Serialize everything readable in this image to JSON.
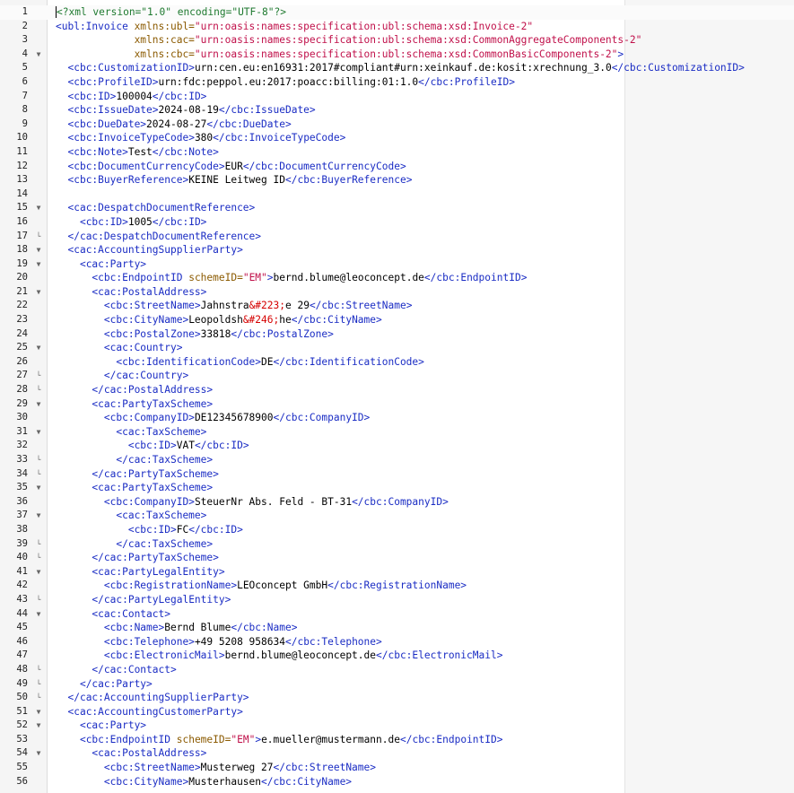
{
  "editor": {
    "lines": [
      {
        "n": "1",
        "fold": "",
        "segments": [
          {
            "t": "<?xml version=\"1.0\" encoding=\"UTF-8\"?>",
            "c": "pi"
          }
        ]
      },
      {
        "n": "2",
        "fold": "",
        "segments": [
          {
            "t": "<ubl:Invoice ",
            "c": "tag"
          },
          {
            "t": "xmlns:ubl=",
            "c": "attr"
          },
          {
            "t": "\"urn:oasis:names:specification:ubl:schema:xsd:Invoice-2\"",
            "c": "str"
          }
        ]
      },
      {
        "n": "3",
        "fold": "",
        "segments": [
          {
            "t": "             ",
            "c": "txt"
          },
          {
            "t": "xmlns:cac=",
            "c": "attr"
          },
          {
            "t": "\"urn:oasis:names:specification:ubl:schema:xsd:CommonAggregateComponents-2\"",
            "c": "str"
          }
        ]
      },
      {
        "n": "4",
        "fold": "▼",
        "segments": [
          {
            "t": "             ",
            "c": "txt"
          },
          {
            "t": "xmlns:cbc=",
            "c": "attr"
          },
          {
            "t": "\"urn:oasis:names:specification:ubl:schema:xsd:CommonBasicComponents-2\"",
            "c": "str"
          },
          {
            "t": ">",
            "c": "tag"
          }
        ]
      },
      {
        "n": "5",
        "fold": "",
        "segments": [
          {
            "t": "  ",
            "c": "txt"
          },
          {
            "t": "<cbc:CustomizationID>",
            "c": "tag"
          },
          {
            "t": "urn:cen.eu:en16931:2017#compliant#urn:xeinkauf.de:kosit:xrechnung_3.0",
            "c": "txt"
          },
          {
            "t": "</cbc:CustomizationID>",
            "c": "tag"
          }
        ]
      },
      {
        "n": "6",
        "fold": "",
        "segments": [
          {
            "t": "  ",
            "c": "txt"
          },
          {
            "t": "<cbc:ProfileID>",
            "c": "tag"
          },
          {
            "t": "urn:fdc:peppol.eu:2017:poacc:billing:01:1.0",
            "c": "txt"
          },
          {
            "t": "</cbc:ProfileID>",
            "c": "tag"
          }
        ]
      },
      {
        "n": "7",
        "fold": "",
        "segments": [
          {
            "t": "  ",
            "c": "txt"
          },
          {
            "t": "<cbc:ID>",
            "c": "tag"
          },
          {
            "t": "100004",
            "c": "txt"
          },
          {
            "t": "</cbc:ID>",
            "c": "tag"
          }
        ]
      },
      {
        "n": "8",
        "fold": "",
        "segments": [
          {
            "t": "  ",
            "c": "txt"
          },
          {
            "t": "<cbc:IssueDate>",
            "c": "tag"
          },
          {
            "t": "2024-08-19",
            "c": "txt"
          },
          {
            "t": "</cbc:IssueDate>",
            "c": "tag"
          }
        ]
      },
      {
        "n": "9",
        "fold": "",
        "segments": [
          {
            "t": "  ",
            "c": "txt"
          },
          {
            "t": "<cbc:DueDate>",
            "c": "tag"
          },
          {
            "t": "2024-08-27",
            "c": "txt"
          },
          {
            "t": "</cbc:DueDate>",
            "c": "tag"
          }
        ]
      },
      {
        "n": "10",
        "fold": "",
        "segments": [
          {
            "t": "  ",
            "c": "txt"
          },
          {
            "t": "<cbc:InvoiceTypeCode>",
            "c": "tag"
          },
          {
            "t": "380",
            "c": "txt"
          },
          {
            "t": "</cbc:InvoiceTypeCode>",
            "c": "tag"
          }
        ]
      },
      {
        "n": "11",
        "fold": "",
        "segments": [
          {
            "t": "  ",
            "c": "txt"
          },
          {
            "t": "<cbc:Note>",
            "c": "tag"
          },
          {
            "t": "Test",
            "c": "txt"
          },
          {
            "t": "</cbc:Note>",
            "c": "tag"
          }
        ]
      },
      {
        "n": "12",
        "fold": "",
        "segments": [
          {
            "t": "  ",
            "c": "txt"
          },
          {
            "t": "<cbc:DocumentCurrencyCode>",
            "c": "tag"
          },
          {
            "t": "EUR",
            "c": "txt"
          },
          {
            "t": "</cbc:DocumentCurrencyCode>",
            "c": "tag"
          }
        ]
      },
      {
        "n": "13",
        "fold": "",
        "segments": [
          {
            "t": "  ",
            "c": "txt"
          },
          {
            "t": "<cbc:BuyerReference>",
            "c": "tag"
          },
          {
            "t": "KEINE Leitweg ID",
            "c": "txt"
          },
          {
            "t": "</cbc:BuyerReference>",
            "c": "tag"
          }
        ]
      },
      {
        "n": "14",
        "fold": "",
        "segments": []
      },
      {
        "n": "15",
        "fold": "▼",
        "segments": [
          {
            "t": "  ",
            "c": "txt"
          },
          {
            "t": "<cac:DespatchDocumentReference>",
            "c": "tag"
          }
        ]
      },
      {
        "n": "16",
        "fold": "",
        "segments": [
          {
            "t": "    ",
            "c": "txt"
          },
          {
            "t": "<cbc:ID>",
            "c": "tag"
          },
          {
            "t": "1005",
            "c": "txt"
          },
          {
            "t": "</cbc:ID>",
            "c": "tag"
          }
        ]
      },
      {
        "n": "17",
        "fold": "└",
        "segments": [
          {
            "t": "  ",
            "c": "txt"
          },
          {
            "t": "</cac:DespatchDocumentReference>",
            "c": "tag"
          }
        ]
      },
      {
        "n": "18",
        "fold": "▼",
        "segments": [
          {
            "t": "  ",
            "c": "txt"
          },
          {
            "t": "<cac:AccountingSupplierParty>",
            "c": "tag"
          }
        ]
      },
      {
        "n": "19",
        "fold": "▼",
        "segments": [
          {
            "t": "    ",
            "c": "txt"
          },
          {
            "t": "<cac:Party>",
            "c": "tag"
          }
        ]
      },
      {
        "n": "20",
        "fold": "",
        "segments": [
          {
            "t": "      ",
            "c": "txt"
          },
          {
            "t": "<cbc:EndpointID ",
            "c": "tag"
          },
          {
            "t": "schemeID=",
            "c": "attr"
          },
          {
            "t": "\"EM\"",
            "c": "str"
          },
          {
            "t": ">",
            "c": "tag"
          },
          {
            "t": "bernd.blume@leoconcept.de",
            "c": "txt"
          },
          {
            "t": "</cbc:EndpointID>",
            "c": "tag"
          }
        ]
      },
      {
        "n": "21",
        "fold": "▼",
        "segments": [
          {
            "t": "      ",
            "c": "txt"
          },
          {
            "t": "<cac:PostalAddress>",
            "c": "tag"
          }
        ]
      },
      {
        "n": "22",
        "fold": "",
        "segments": [
          {
            "t": "        ",
            "c": "txt"
          },
          {
            "t": "<cbc:StreetName>",
            "c": "tag"
          },
          {
            "t": "Jahnstra",
            "c": "txt"
          },
          {
            "t": "&#223;",
            "c": "ent"
          },
          {
            "t": "e 29",
            "c": "txt"
          },
          {
            "t": "</cbc:StreetName>",
            "c": "tag"
          }
        ]
      },
      {
        "n": "23",
        "fold": "",
        "segments": [
          {
            "t": "        ",
            "c": "txt"
          },
          {
            "t": "<cbc:CityName>",
            "c": "tag"
          },
          {
            "t": "Leopoldsh",
            "c": "txt"
          },
          {
            "t": "&#246;",
            "c": "ent"
          },
          {
            "t": "he",
            "c": "txt"
          },
          {
            "t": "</cbc:CityName>",
            "c": "tag"
          }
        ]
      },
      {
        "n": "24",
        "fold": "",
        "segments": [
          {
            "t": "        ",
            "c": "txt"
          },
          {
            "t": "<cbc:PostalZone>",
            "c": "tag"
          },
          {
            "t": "33818",
            "c": "txt"
          },
          {
            "t": "</cbc:PostalZone>",
            "c": "tag"
          }
        ]
      },
      {
        "n": "25",
        "fold": "▼",
        "segments": [
          {
            "t": "        ",
            "c": "txt"
          },
          {
            "t": "<cac:Country>",
            "c": "tag"
          }
        ]
      },
      {
        "n": "26",
        "fold": "",
        "segments": [
          {
            "t": "          ",
            "c": "txt"
          },
          {
            "t": "<cbc:IdentificationCode>",
            "c": "tag"
          },
          {
            "t": "DE",
            "c": "txt"
          },
          {
            "t": "</cbc:IdentificationCode>",
            "c": "tag"
          }
        ]
      },
      {
        "n": "27",
        "fold": "└",
        "segments": [
          {
            "t": "        ",
            "c": "txt"
          },
          {
            "t": "</cac:Country>",
            "c": "tag"
          }
        ]
      },
      {
        "n": "28",
        "fold": "└",
        "segments": [
          {
            "t": "      ",
            "c": "txt"
          },
          {
            "t": "</cac:PostalAddress>",
            "c": "tag"
          }
        ]
      },
      {
        "n": "29",
        "fold": "▼",
        "segments": [
          {
            "t": "      ",
            "c": "txt"
          },
          {
            "t": "<cac:PartyTaxScheme>",
            "c": "tag"
          }
        ]
      },
      {
        "n": "30",
        "fold": "",
        "segments": [
          {
            "t": "        ",
            "c": "txt"
          },
          {
            "t": "<cbc:CompanyID>",
            "c": "tag"
          },
          {
            "t": "DE12345678900",
            "c": "txt"
          },
          {
            "t": "</cbc:CompanyID>",
            "c": "tag"
          }
        ]
      },
      {
        "n": "31",
        "fold": "▼",
        "segments": [
          {
            "t": "          ",
            "c": "txt"
          },
          {
            "t": "<cac:TaxScheme>",
            "c": "tag"
          }
        ]
      },
      {
        "n": "32",
        "fold": "",
        "segments": [
          {
            "t": "            ",
            "c": "txt"
          },
          {
            "t": "<cbc:ID>",
            "c": "tag"
          },
          {
            "t": "VAT",
            "c": "txt"
          },
          {
            "t": "</cbc:ID>",
            "c": "tag"
          }
        ]
      },
      {
        "n": "33",
        "fold": "└",
        "segments": [
          {
            "t": "          ",
            "c": "txt"
          },
          {
            "t": "</cac:TaxScheme>",
            "c": "tag"
          }
        ]
      },
      {
        "n": "34",
        "fold": "└",
        "segments": [
          {
            "t": "      ",
            "c": "txt"
          },
          {
            "t": "</cac:PartyTaxScheme>",
            "c": "tag"
          }
        ]
      },
      {
        "n": "35",
        "fold": "▼",
        "segments": [
          {
            "t": "      ",
            "c": "txt"
          },
          {
            "t": "<cac:PartyTaxScheme>",
            "c": "tag"
          }
        ]
      },
      {
        "n": "36",
        "fold": "",
        "segments": [
          {
            "t": "        ",
            "c": "txt"
          },
          {
            "t": "<cbc:CompanyID>",
            "c": "tag"
          },
          {
            "t": "SteuerNr Abs. Feld - BT-31",
            "c": "txt"
          },
          {
            "t": "</cbc:CompanyID>",
            "c": "tag"
          }
        ]
      },
      {
        "n": "37",
        "fold": "▼",
        "segments": [
          {
            "t": "          ",
            "c": "txt"
          },
          {
            "t": "<cac:TaxScheme>",
            "c": "tag"
          }
        ]
      },
      {
        "n": "38",
        "fold": "",
        "segments": [
          {
            "t": "            ",
            "c": "txt"
          },
          {
            "t": "<cbc:ID>",
            "c": "tag"
          },
          {
            "t": "FC",
            "c": "txt"
          },
          {
            "t": "</cbc:ID>",
            "c": "tag"
          }
        ]
      },
      {
        "n": "39",
        "fold": "└",
        "segments": [
          {
            "t": "          ",
            "c": "txt"
          },
          {
            "t": "</cac:TaxScheme>",
            "c": "tag"
          }
        ]
      },
      {
        "n": "40",
        "fold": "└",
        "segments": [
          {
            "t": "      ",
            "c": "txt"
          },
          {
            "t": "</cac:PartyTaxScheme>",
            "c": "tag"
          }
        ]
      },
      {
        "n": "41",
        "fold": "▼",
        "segments": [
          {
            "t": "      ",
            "c": "txt"
          },
          {
            "t": "<cac:PartyLegalEntity>",
            "c": "tag"
          }
        ]
      },
      {
        "n": "42",
        "fold": "",
        "segments": [
          {
            "t": "        ",
            "c": "txt"
          },
          {
            "t": "<cbc:RegistrationName>",
            "c": "tag"
          },
          {
            "t": "LEOconcept GmbH",
            "c": "txt"
          },
          {
            "t": "</cbc:RegistrationName>",
            "c": "tag"
          }
        ]
      },
      {
        "n": "43",
        "fold": "└",
        "segments": [
          {
            "t": "      ",
            "c": "txt"
          },
          {
            "t": "</cac:PartyLegalEntity>",
            "c": "tag"
          }
        ]
      },
      {
        "n": "44",
        "fold": "▼",
        "segments": [
          {
            "t": "      ",
            "c": "txt"
          },
          {
            "t": "<cac:Contact>",
            "c": "tag"
          }
        ]
      },
      {
        "n": "45",
        "fold": "",
        "segments": [
          {
            "t": "        ",
            "c": "txt"
          },
          {
            "t": "<cbc:Name>",
            "c": "tag"
          },
          {
            "t": "Bernd Blume",
            "c": "txt"
          },
          {
            "t": "</cbc:Name>",
            "c": "tag"
          }
        ]
      },
      {
        "n": "46",
        "fold": "",
        "segments": [
          {
            "t": "        ",
            "c": "txt"
          },
          {
            "t": "<cbc:Telephone>",
            "c": "tag"
          },
          {
            "t": "+49 5208 958634",
            "c": "txt"
          },
          {
            "t": "</cbc:Telephone>",
            "c": "tag"
          }
        ]
      },
      {
        "n": "47",
        "fold": "",
        "segments": [
          {
            "t": "        ",
            "c": "txt"
          },
          {
            "t": "<cbc:ElectronicMail>",
            "c": "tag"
          },
          {
            "t": "bernd.blume@leoconcept.de",
            "c": "txt"
          },
          {
            "t": "</cbc:ElectronicMail>",
            "c": "tag"
          }
        ]
      },
      {
        "n": "48",
        "fold": "└",
        "segments": [
          {
            "t": "      ",
            "c": "txt"
          },
          {
            "t": "</cac:Contact>",
            "c": "tag"
          }
        ]
      },
      {
        "n": "49",
        "fold": "└",
        "segments": [
          {
            "t": "    ",
            "c": "txt"
          },
          {
            "t": "</cac:Party>",
            "c": "tag"
          }
        ]
      },
      {
        "n": "50",
        "fold": "└",
        "segments": [
          {
            "t": "  ",
            "c": "txt"
          },
          {
            "t": "</cac:AccountingSupplierParty>",
            "c": "tag"
          }
        ]
      },
      {
        "n": "51",
        "fold": "▼",
        "segments": [
          {
            "t": "  ",
            "c": "txt"
          },
          {
            "t": "<cac:AccountingCustomerParty>",
            "c": "tag"
          }
        ]
      },
      {
        "n": "52",
        "fold": "▼",
        "segments": [
          {
            "t": "    ",
            "c": "txt"
          },
          {
            "t": "<cac:Party>",
            "c": "tag"
          }
        ]
      },
      {
        "n": "53",
        "fold": "",
        "segments": [
          {
            "t": "    ",
            "c": "txt"
          },
          {
            "t": "<cbc:EndpointID ",
            "c": "tag"
          },
          {
            "t": "schemeID=",
            "c": "attr"
          },
          {
            "t": "\"EM\"",
            "c": "str"
          },
          {
            "t": ">",
            "c": "tag"
          },
          {
            "t": "e.mueller@mustermann.de",
            "c": "txt"
          },
          {
            "t": "</cbc:EndpointID>",
            "c": "tag"
          }
        ]
      },
      {
        "n": "54",
        "fold": "▼",
        "segments": [
          {
            "t": "      ",
            "c": "txt"
          },
          {
            "t": "<cac:PostalAddress>",
            "c": "tag"
          }
        ]
      },
      {
        "n": "55",
        "fold": "",
        "segments": [
          {
            "t": "        ",
            "c": "txt"
          },
          {
            "t": "<cbc:StreetName>",
            "c": "tag"
          },
          {
            "t": "Musterweg 27",
            "c": "txt"
          },
          {
            "t": "</cbc:StreetName>",
            "c": "tag"
          }
        ]
      },
      {
        "n": "56",
        "fold": "",
        "segments": [
          {
            "t": "        ",
            "c": "txt"
          },
          {
            "t": "<cbc:CityName>",
            "c": "tag"
          },
          {
            "t": "Musterhausen",
            "c": "txt"
          },
          {
            "t": "</cbc:CityName>",
            "c": "tag"
          }
        ]
      }
    ]
  },
  "colors": {
    "tag": "#1a2cc4",
    "attribute": "#8b5a00",
    "string": "#c0104a",
    "entity": "#d50000",
    "processing_instruction": "#1f7a30",
    "gutter_background": "#f5f5f5"
  },
  "icons": {
    "fold_open": "triangle-down-icon",
    "fold_end": "fold-end-icon"
  }
}
